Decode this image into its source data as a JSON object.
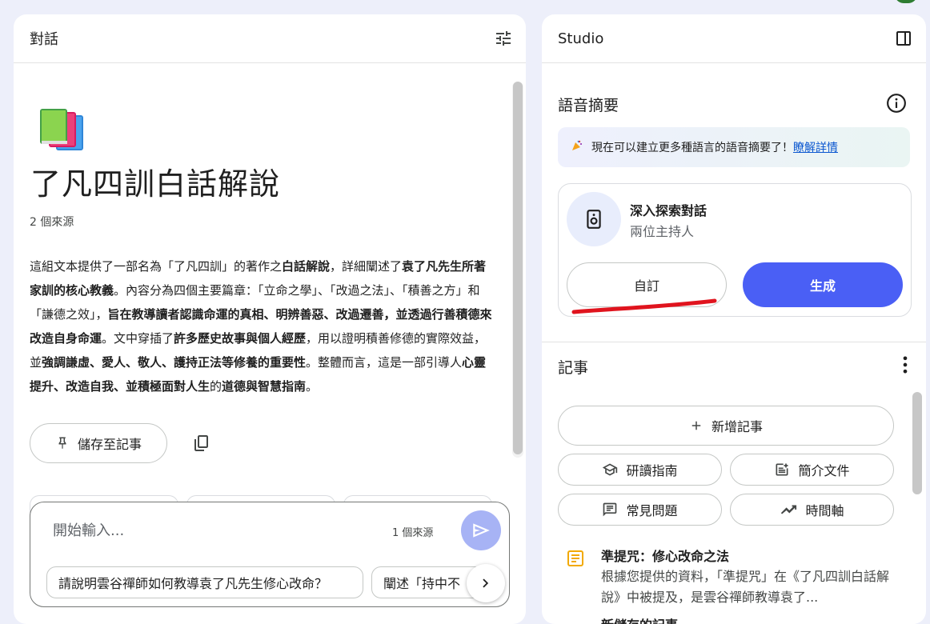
{
  "chat": {
    "header_title": "對話",
    "settings_icon": "tune-icon",
    "notebook_emoji_icon": "books-icon",
    "notebook_title": "了凡四訓白話解說",
    "source_count": "2 個來源",
    "summary": [
      {
        "t": "這組文本提供了一部名為「了凡四訓」的著作之",
        "b": false
      },
      {
        "t": "白話解說",
        "b": true
      },
      {
        "t": "，詳細闡述了",
        "b": false
      },
      {
        "t": "袁了凡先生所著家訓的核心教義",
        "b": true
      },
      {
        "t": "。內容分為四個主要篇章：「立命之學」、「改過之法」、「積善之方」和「謙德之效」，",
        "b": false
      },
      {
        "t": "旨在教導讀者認識命運的真相、明辨善惡、改過遷善，並透過行善積德來改造自身命運",
        "b": true
      },
      {
        "t": "。文中穿插了",
        "b": false
      },
      {
        "t": "許多歷史故事與個人經歷",
        "b": true
      },
      {
        "t": "，用以證明積善修德的實際效益，並",
        "b": false
      },
      {
        "t": "強調謙虛、愛人、敬人、護持正法等修養的重要性",
        "b": true
      },
      {
        "t": "。整體而言，這是一部引導人",
        "b": false
      },
      {
        "t": "心靈提升、改造自我、並積極面對人生",
        "b": true
      },
      {
        "t": "的",
        "b": false
      },
      {
        "t": "道德與智慧指南",
        "b": true
      },
      {
        "t": "。",
        "b": false
      }
    ],
    "save_note_label": "儲存至記事",
    "composer": {
      "placeholder": "開始輸入...",
      "source_count": "1 個來源"
    },
    "suggestions": [
      "請說明雲谷禪師如何教導袁了凡先生修心改命？",
      "闡述「持中不"
    ]
  },
  "studio": {
    "header_title": "Studio",
    "audio_section_title": "語音摘要",
    "banner_text": "現在可以建立更多種語言的語音摘要了！",
    "banner_link": "瞭解詳情",
    "audio_card": {
      "title": "深入探索對話",
      "subtitle": "兩位主持人",
      "customize_label": "自訂",
      "generate_label": "生成"
    },
    "notes_section_title": "記事",
    "add_note_label": "新增記事",
    "tools": [
      {
        "label": "研讀指南",
        "icon": "school-icon"
      },
      {
        "label": "簡介文件",
        "icon": "doc-icon"
      },
      {
        "label": "常見問題",
        "icon": "faq-icon"
      },
      {
        "label": "時間軸",
        "icon": "timeline-icon"
      }
    ],
    "note": {
      "title": "準提咒：修心改命之法",
      "preview": "根據您提供的資料，「準提咒」在《了凡四訓白話解說》中被提及，是雲谷禪師教導袁了...",
      "next_peek": "新儲存的記事"
    }
  },
  "colors": {
    "accent": "#4a5ff5",
    "send_disabled": "#a7b3f5",
    "annotation_red": "#e0141e",
    "background": "#edeffa"
  }
}
